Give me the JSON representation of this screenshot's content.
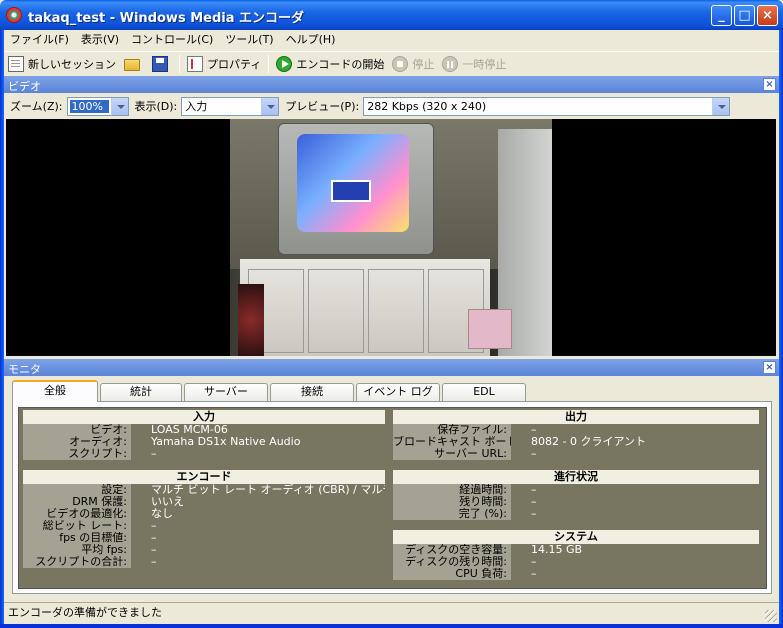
{
  "window": {
    "title": "takaq_test - Windows Media エンコーダ",
    "min_glyph": "_",
    "max_glyph": "□",
    "close_glyph": "×"
  },
  "menubar": [
    {
      "label": "ファイル(F)"
    },
    {
      "label": "表示(V)"
    },
    {
      "label": "コントロール(C)"
    },
    {
      "label": "ツール(T)"
    },
    {
      "label": "ヘルプ(H)"
    }
  ],
  "toolbar": {
    "new_session": "新しいセッション",
    "properties": "プロパティ",
    "start_encoding": "エンコードの開始",
    "stop": "停止",
    "pause": "一時停止",
    "icons": {
      "new_session": "new-document-icon",
      "open": "open-folder-icon",
      "save": "save-disk-icon",
      "properties": "properties-icon",
      "start": "play-icon",
      "stop": "stop-icon",
      "pause": "pause-icon"
    }
  },
  "video_panel": {
    "title": "ビデオ",
    "zoom_label": "ズーム(Z):",
    "zoom_value": "100%",
    "display_label": "表示(D):",
    "display_value": "入力",
    "preview_label": "プレビュー(P):",
    "preview_value": "282 Kbps (320 x 240)"
  },
  "monitor_panel": {
    "title": "モニタ",
    "tabs": [
      {
        "label": "全般"
      },
      {
        "label": "統計"
      },
      {
        "label": "サーバー"
      },
      {
        "label": "接続"
      },
      {
        "label": "イベント ログ"
      },
      {
        "label": "EDL"
      }
    ],
    "input": {
      "title": "入力",
      "rows": [
        {
          "k": "ビデオ:",
          "v": "LOAS MCM-06"
        },
        {
          "k": "オーディオ:",
          "v": "Yamaha DS1x Native Audio"
        },
        {
          "k": "スクリプト:",
          "v": "–"
        }
      ]
    },
    "output": {
      "title": "出力",
      "rows": [
        {
          "k": "保存ファイル:",
          "v": "–"
        },
        {
          "k": "ブロードキャスト ポート:",
          "v": "8082 - 0 クライアント"
        },
        {
          "k": "サーバー URL:",
          "v": "–"
        }
      ]
    },
    "encode": {
      "title": "エンコード",
      "rows": [
        {
          "k": "設定:",
          "v": "マルチ ビット レート オーディオ (CBR) / マルチ ビッ"
        },
        {
          "k": "DRM 保護:",
          "v": "いいえ"
        },
        {
          "k": "ビデオの最適化:",
          "v": "なし"
        },
        {
          "k": "総ビット レート:",
          "v": "–"
        },
        {
          "k": "fps の目標値:",
          "v": "–"
        },
        {
          "k": "平均 fps:",
          "v": "–"
        },
        {
          "k": "スクリプトの合計:",
          "v": "–"
        }
      ]
    },
    "progress": {
      "title": "進行状況",
      "rows": [
        {
          "k": "経過時間:",
          "v": "–"
        },
        {
          "k": "残り時間:",
          "v": "–"
        },
        {
          "k": "完了 (%):",
          "v": "–"
        }
      ]
    },
    "system": {
      "title": "システム",
      "rows": [
        {
          "k": "ディスクの空き容量:",
          "v": "14.15 GB"
        },
        {
          "k": "ディスクの残り時間:",
          "v": "–"
        },
        {
          "k": "CPU 負荷:",
          "v": "–"
        }
      ]
    }
  },
  "statusbar": {
    "text": "エンコーダの準備ができました"
  }
}
